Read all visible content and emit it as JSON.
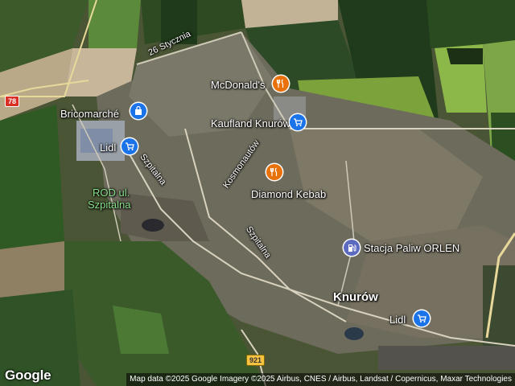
{
  "map": {
    "places": [
      {
        "name": "Bricomarché",
        "category": "shop",
        "icon": "shopping-bag-icon"
      },
      {
        "name": "Lidl",
        "category": "shop",
        "icon": "shopping-cart-icon"
      },
      {
        "name": "McDonald's",
        "category": "food",
        "icon": "restaurant-icon"
      },
      {
        "name": "Kaufland Knurów",
        "category": "shop",
        "icon": "shopping-cart-icon"
      },
      {
        "name": "Diamond Kebab",
        "category": "food",
        "icon": "restaurant-icon"
      },
      {
        "name": "Stacja Paliw ORLEN",
        "category": "fuel",
        "icon": "gas-station-icon"
      },
      {
        "name": "Lidl",
        "category": "shop",
        "icon": "shopping-cart-icon"
      }
    ],
    "area_labels": {
      "rod_line1": "ROD ul.",
      "rod_line2": "Szpitalna",
      "town": "Knurów"
    },
    "roads": {
      "street_26": "26 Stycznia",
      "szpitalna_1": "Szpitalna",
      "kosmonautow": "Kosmonautów",
      "szpitalna_2": "Szpitalna"
    },
    "shields": {
      "road_78": "78",
      "road_921": "921"
    },
    "attribution": "Map data ©2025 Google Imagery ©2025 Airbus, CNES / Airbus, Landsat / Copernicus, Maxar Technologies",
    "logo": "Google",
    "colors": {
      "shop_pin": "#1a73e8",
      "food_pin": "#e8710a",
      "fuel_pin": "#5c6bc0",
      "park_label": "#8be08b",
      "road_78_shield": "#d93025",
      "road_921_shield": "#f6c343"
    }
  }
}
